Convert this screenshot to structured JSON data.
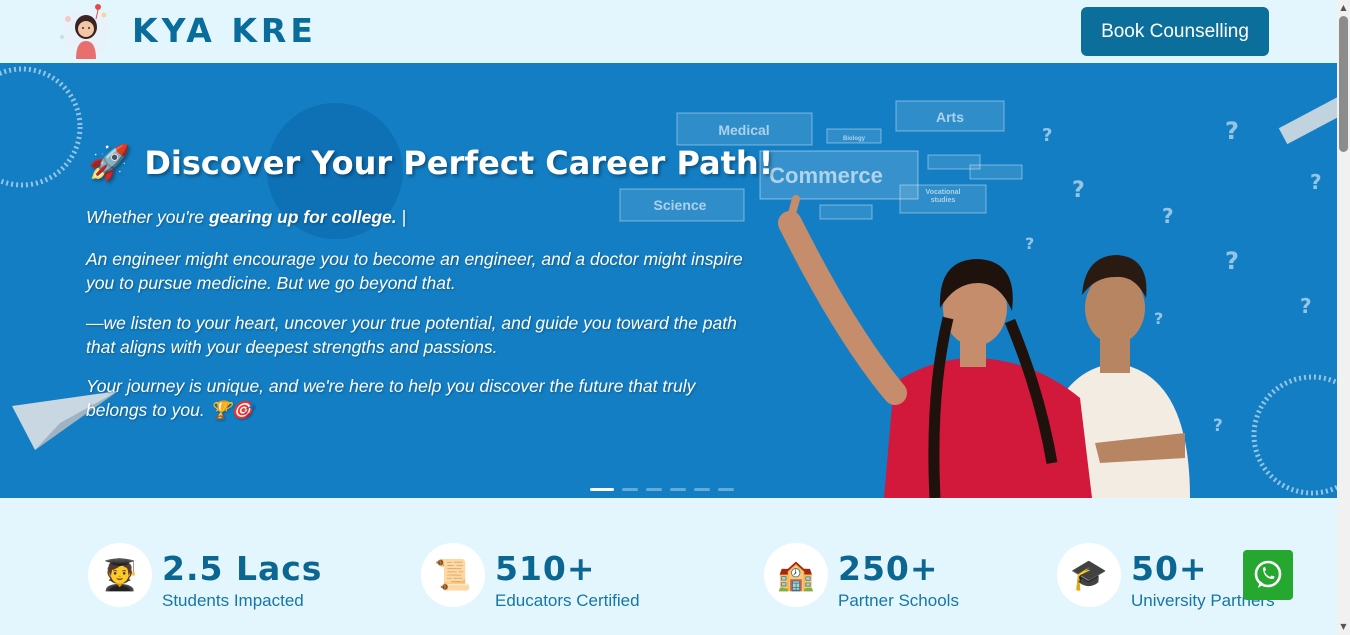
{
  "header": {
    "logo_text": "KYA KRE",
    "book_button": "Book Counselling"
  },
  "hero": {
    "title": "Discover Your Perfect Career Path!",
    "title_icon": "🚀",
    "typing_prefix": "Whether you're ",
    "typing_bold": "gearing up for college.",
    "typing_cursor": " |",
    "paragraph_1": "An engineer might encourage you to become an engineer, and a doctor might inspire you to pursue medicine. But we go beyond that.",
    "paragraph_2": "—we listen to your heart, uncover your true potential, and guide you toward the path that aligns with your deepest strengths and passions.",
    "paragraph_3": "Your journey is unique, and we're here to help you discover the future that truly belongs to you. 🏆🎯",
    "career_labels": [
      "Medical",
      "Arts",
      "Biology",
      "Commerce",
      "Science",
      "Vocational studies"
    ],
    "carousel": {
      "slides": 6,
      "active": 0
    }
  },
  "stats": [
    {
      "icon": "🧑‍🎓",
      "icon_name": "student-icon",
      "value": "2.5 Lacs",
      "label": "Students Impacted"
    },
    {
      "icon": "📜",
      "icon_name": "certificate-scroll-icon",
      "value": "510+",
      "label": "Educators Certified"
    },
    {
      "icon": "🏫",
      "icon_name": "school-icon",
      "value": "250+",
      "label": "Partner Schools"
    },
    {
      "icon": "🎓",
      "icon_name": "graduation-cap-icon",
      "value": "50+",
      "label": "University Partners"
    }
  ],
  "colors": {
    "page_bg": "#e3f6fd",
    "hero_bg": "#137ec3",
    "brand": "#0b6691",
    "button": "#0c6f9b",
    "whatsapp": "#25a730"
  }
}
